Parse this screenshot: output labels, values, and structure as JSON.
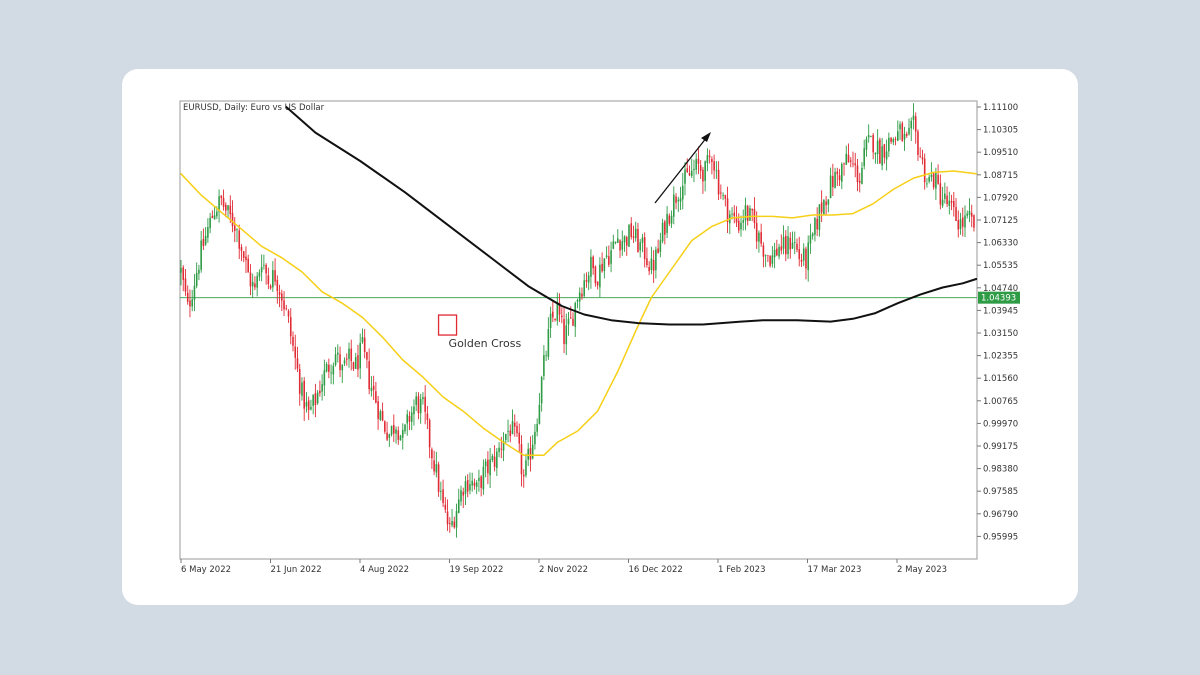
{
  "chart_data": {
    "type": "candlestick",
    "title": "EURUSD, Daily:  Euro vs US Dollar",
    "y_ticks": [
      "1.11100",
      "1.10305",
      "1.09510",
      "1.08715",
      "1.07920",
      "1.07125",
      "1.06330",
      "1.05535",
      "1.04740",
      "1.03945",
      "1.03150",
      "1.02355",
      "1.01560",
      "1.00765",
      "0.99970",
      "0.99175",
      "0.98380",
      "0.97585",
      "0.96790",
      "0.95995"
    ],
    "x_ticks": [
      "6 May 2022",
      "21 Jun 2022",
      "4 Aug 2022",
      "19 Sep 2022",
      "2 Nov 2022",
      "16 Dec 2022",
      "1 Feb 2023",
      "17 Mar 2023",
      "2 May 2023"
    ],
    "ylim": [
      0.9565,
      1.113
    ],
    "current_price": {
      "label": "1.04393",
      "value": 1.04393,
      "color": "#2e9b45"
    },
    "annotation": {
      "text": "Golden Cross",
      "x_index": 119,
      "price": 1.0343
    },
    "colors": {
      "bull": "#2e9b45",
      "bear": "#e02a34",
      "ma_fast": "#f6cf17",
      "ma_slow": "#111111"
    },
    "close_path": [
      [
        0,
        1.053
      ],
      [
        3,
        1.04
      ],
      [
        6,
        1.05
      ],
      [
        9,
        1.06
      ],
      [
        12,
        1.068
      ],
      [
        15,
        1.075
      ],
      [
        18,
        1.078
      ],
      [
        21,
        1.073
      ],
      [
        24,
        1.07
      ],
      [
        27,
        1.062
      ],
      [
        30,
        1.052
      ],
      [
        33,
        1.046
      ],
      [
        36,
        1.058
      ],
      [
        39,
        1.05
      ],
      [
        42,
        1.052
      ],
      [
        45,
        1.045
      ],
      [
        48,
        1.035
      ],
      [
        51,
        1.022
      ],
      [
        54,
        1.01
      ],
      [
        57,
        1.003
      ],
      [
        60,
        1.008
      ],
      [
        63,
        1.015
      ],
      [
        66,
        1.02
      ],
      [
        69,
        1.024
      ],
      [
        72,
        1.018
      ],
      [
        75,
        1.022
      ],
      [
        78,
        1.02
      ],
      [
        81,
        1.026
      ],
      [
        84,
        1.015
      ],
      [
        87,
        1.008
      ],
      [
        90,
        1.0
      ],
      [
        93,
        0.996
      ],
      [
        96,
        1.0
      ],
      [
        99,
        0.994
      ],
      [
        102,
        1.002
      ],
      [
        105,
        1.007
      ],
      [
        108,
        1.005
      ],
      [
        111,
        0.993
      ],
      [
        114,
        0.982
      ],
      [
        117,
        0.97
      ],
      [
        120,
        0.962
      ],
      [
        123,
        0.97
      ],
      [
        126,
        0.978
      ],
      [
        129,
        0.98
      ],
      [
        132,
        0.976
      ],
      [
        135,
        0.982
      ],
      [
        138,
        0.985
      ],
      [
        141,
        0.988
      ],
      [
        144,
        0.995
      ],
      [
        147,
        0.998
      ],
      [
        150,
        0.993
      ],
      [
        153,
        0.98
      ],
      [
        156,
        0.99
      ],
      [
        159,
        1.003
      ],
      [
        162,
        1.02
      ],
      [
        165,
        1.035
      ],
      [
        168,
        1.04
      ],
      [
        171,
        1.03
      ],
      [
        174,
        1.035
      ],
      [
        177,
        1.045
      ],
      [
        180,
        1.05
      ],
      [
        183,
        1.055
      ],
      [
        186,
        1.052
      ],
      [
        189,
        1.058
      ],
      [
        192,
        1.06
      ],
      [
        195,
        1.065
      ],
      [
        198,
        1.064
      ],
      [
        201,
        1.067
      ],
      [
        204,
        1.063
      ],
      [
        207,
        1.06
      ],
      [
        210,
        1.054
      ],
      [
        213,
        1.06
      ],
      [
        216,
        1.07
      ],
      [
        219,
        1.076
      ],
      [
        222,
        1.082
      ],
      [
        225,
        1.085
      ],
      [
        228,
        1.088
      ],
      [
        231,
        1.09
      ],
      [
        234,
        1.088
      ],
      [
        237,
        1.095
      ],
      [
        240,
        1.084
      ],
      [
        243,
        1.076
      ],
      [
        246,
        1.072
      ],
      [
        249,
        1.07
      ],
      [
        252,
        1.074
      ],
      [
        255,
        1.071
      ],
      [
        258,
        1.065
      ],
      [
        261,
        1.06
      ],
      [
        264,
        1.058
      ],
      [
        267,
        1.062
      ],
      [
        270,
        1.061
      ],
      [
        273,
        1.065
      ],
      [
        276,
        1.058
      ],
      [
        279,
        1.057
      ],
      [
        282,
        1.065
      ],
      [
        285,
        1.074
      ],
      [
        288,
        1.08
      ],
      [
        291,
        1.085
      ],
      [
        294,
        1.088
      ],
      [
        297,
        1.092
      ],
      [
        300,
        1.09
      ],
      [
        303,
        1.086
      ],
      [
        306,
        1.097
      ],
      [
        309,
        1.099
      ],
      [
        312,
        1.095
      ],
      [
        315,
        1.098
      ],
      [
        318,
        1.1
      ],
      [
        321,
        1.102
      ],
      [
        324,
        1.098
      ],
      [
        327,
        1.104
      ],
      [
        330,
        1.094
      ],
      [
        333,
        1.085
      ],
      [
        336,
        1.086
      ],
      [
        339,
        1.08
      ],
      [
        342,
        1.077
      ],
      [
        345,
        1.073
      ],
      [
        348,
        1.07
      ],
      [
        352,
        1.071
      ],
      [
        355,
        1.069
      ]
    ],
    "ma_fast": [
      [
        0,
        1.0875
      ],
      [
        9,
        1.08
      ],
      [
        18,
        1.074
      ],
      [
        27,
        1.068
      ],
      [
        36,
        1.062
      ],
      [
        45,
        1.058
      ],
      [
        54,
        1.053
      ],
      [
        63,
        1.046
      ],
      [
        72,
        1.042
      ],
      [
        81,
        1.037
      ],
      [
        90,
        1.03
      ],
      [
        99,
        1.022
      ],
      [
        108,
        1.016
      ],
      [
        117,
        1.009
      ],
      [
        126,
        1.004
      ],
      [
        135,
        0.998
      ],
      [
        144,
        0.993
      ],
      [
        153,
        0.9885
      ],
      [
        162,
        0.9885
      ],
      [
        168,
        0.993
      ],
      [
        177,
        0.997
      ],
      [
        186,
        1.004
      ],
      [
        195,
        1.018
      ],
      [
        204,
        1.034
      ],
      [
        210,
        1.044
      ],
      [
        219,
        1.054
      ],
      [
        228,
        1.064
      ],
      [
        237,
        1.069
      ],
      [
        246,
        1.072
      ],
      [
        255,
        1.0725
      ],
      [
        264,
        1.0725
      ],
      [
        273,
        1.072
      ],
      [
        282,
        1.073
      ],
      [
        291,
        1.073
      ],
      [
        300,
        1.0735
      ],
      [
        309,
        1.077
      ],
      [
        318,
        1.082
      ],
      [
        327,
        1.086
      ],
      [
        336,
        1.088
      ],
      [
        345,
        1.0885
      ],
      [
        355,
        1.0875
      ]
    ],
    "ma_slow": [
      [
        47,
        1.111
      ],
      [
        60,
        1.102
      ],
      [
        80,
        1.092
      ],
      [
        100,
        1.081
      ],
      [
        120,
        1.069
      ],
      [
        140,
        1.057
      ],
      [
        155,
        1.048
      ],
      [
        170,
        1.041
      ],
      [
        180,
        1.038
      ],
      [
        192,
        1.036
      ],
      [
        204,
        1.035
      ],
      [
        218,
        1.0345
      ],
      [
        233,
        1.0345
      ],
      [
        250,
        1.0355
      ],
      [
        260,
        1.036
      ],
      [
        275,
        1.036
      ],
      [
        290,
        1.0355
      ],
      [
        300,
        1.0365
      ],
      [
        310,
        1.0385
      ],
      [
        320,
        1.042
      ],
      [
        330,
        1.045
      ],
      [
        340,
        1.0475
      ],
      [
        349,
        1.049
      ],
      [
        355,
        1.0505
      ]
    ]
  }
}
